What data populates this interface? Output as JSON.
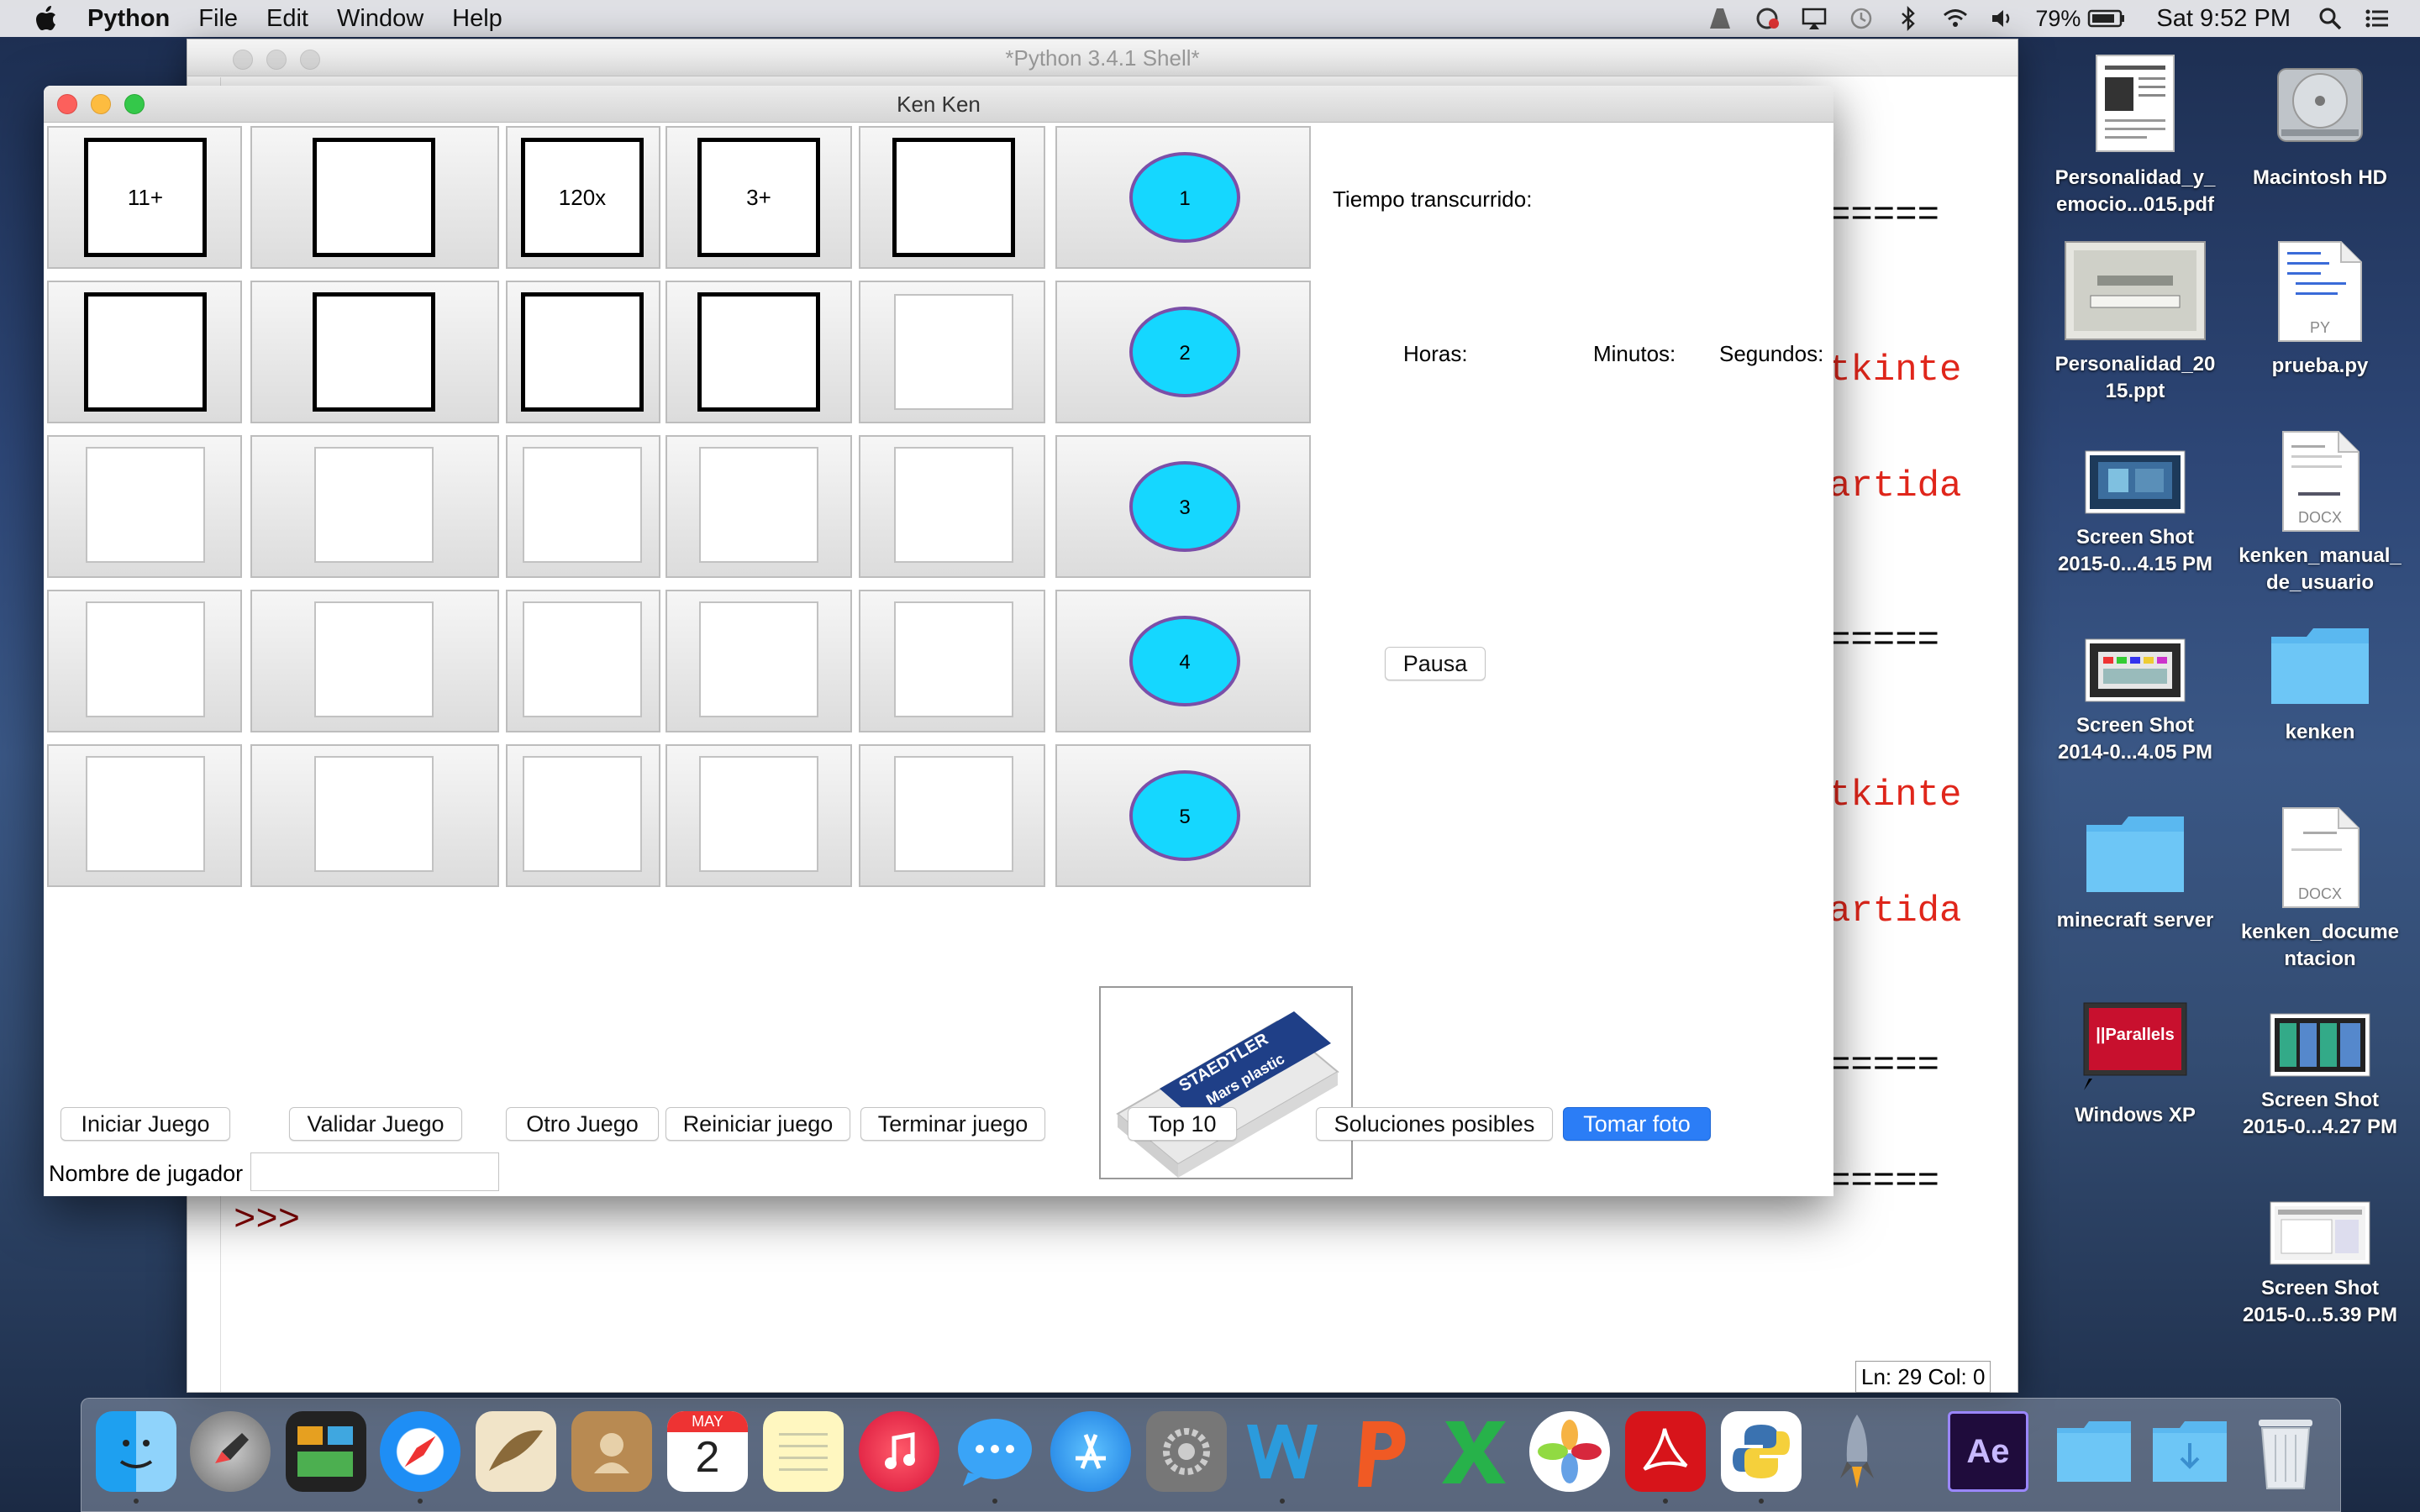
{
  "menubar": {
    "app_name": "Python",
    "items": [
      "File",
      "Edit",
      "Window",
      "Help"
    ],
    "battery": "79%",
    "clock": "Sat 9:52 PM"
  },
  "shell_window": {
    "title": "*Python 3.4.1 Shell*",
    "lines": [
      {
        "text": "=====",
        "color": "black"
      },
      {
        "text": "tkinte",
        "color": "red"
      },
      {
        "text": "artida",
        "color": "red"
      },
      {
        "text": "=====",
        "color": "black"
      },
      {
        "text": "tkinte",
        "color": "red"
      },
      {
        "text": "artida",
        "color": "red"
      },
      {
        "text": "=====",
        "color": "black"
      },
      {
        "text": "=====",
        "color": "black"
      }
    ],
    "prompt": ">>>",
    "status": "Ln: 29 Col: 0"
  },
  "kenken": {
    "title": "Ken Ken",
    "cages": [
      "11+",
      "",
      "120x",
      "3+",
      ""
    ],
    "numbers": [
      "1",
      "2",
      "3",
      "4",
      "5"
    ],
    "number_fill": "#15d7ff",
    "number_stroke": "#7b4fa8",
    "timer_label": "Tiempo transcurrido:",
    "horas_label": "Horas:",
    "minutos_label": "Minutos:",
    "segundos_label": "Segundos:",
    "pause_label": "Pausa",
    "eraser_brand": "STAEDTLER",
    "eraser_model": "Mars plastic",
    "buttons": {
      "iniciar": "Iniciar Juego",
      "validar": "Validar Juego",
      "otro": "Otro Juego",
      "reiniciar": "Reiniciar juego",
      "terminar": "Terminar juego",
      "top10": "Top 10",
      "soluciones": "Soluciones posibles",
      "foto": "Tomar foto"
    },
    "player_label": "Nombre de jugador",
    "player_name": ""
  },
  "desktop": {
    "items": [
      {
        "label1": "Personalidad_y_",
        "label2": "emocio...015.pdf",
        "icon": "pdf-document-icon"
      },
      {
        "label1": "Macintosh HD",
        "label2": "",
        "icon": "hard-drive-icon"
      },
      {
        "label1": "Personalidad_20",
        "label2": "15.ppt",
        "icon": "ppt-document-icon"
      },
      {
        "label1": "prueba.py",
        "label2": "",
        "icon": "python-file-icon"
      },
      {
        "label1": "Screen Shot",
        "label2": "2015-0...4.15 PM",
        "icon": "screenshot-icon"
      },
      {
        "label1": "kenken_manual_",
        "label2": "de_usuario",
        "icon": "docx-file-icon"
      },
      {
        "label1": "Screen Shot",
        "label2": "2014-0...4.05 PM",
        "icon": "screenshot-icon"
      },
      {
        "label1": "kenken",
        "label2": "",
        "icon": "folder-icon"
      },
      {
        "label1": "minecraft server",
        "label2": "",
        "icon": "folder-icon"
      },
      {
        "label1": "kenken_docume",
        "label2": "ntacion",
        "icon": "docx-file-icon"
      },
      {
        "label1": "Windows XP",
        "label2": "",
        "icon": "parallels-vm-icon"
      },
      {
        "label1": "Screen Shot",
        "label2": "2015-0...4.27 PM",
        "icon": "screenshot-icon"
      },
      {
        "label1": "Screen Shot",
        "label2": "2015-0...5.39 PM",
        "icon": "screenshot-icon"
      }
    ],
    "docx_tag": "DOCX",
    "py_tag": "PY",
    "parallels_text": "||Parallels"
  },
  "dock": {
    "calendar_month": "MAY",
    "calendar_day": "2",
    "ae_label": "Ae"
  }
}
